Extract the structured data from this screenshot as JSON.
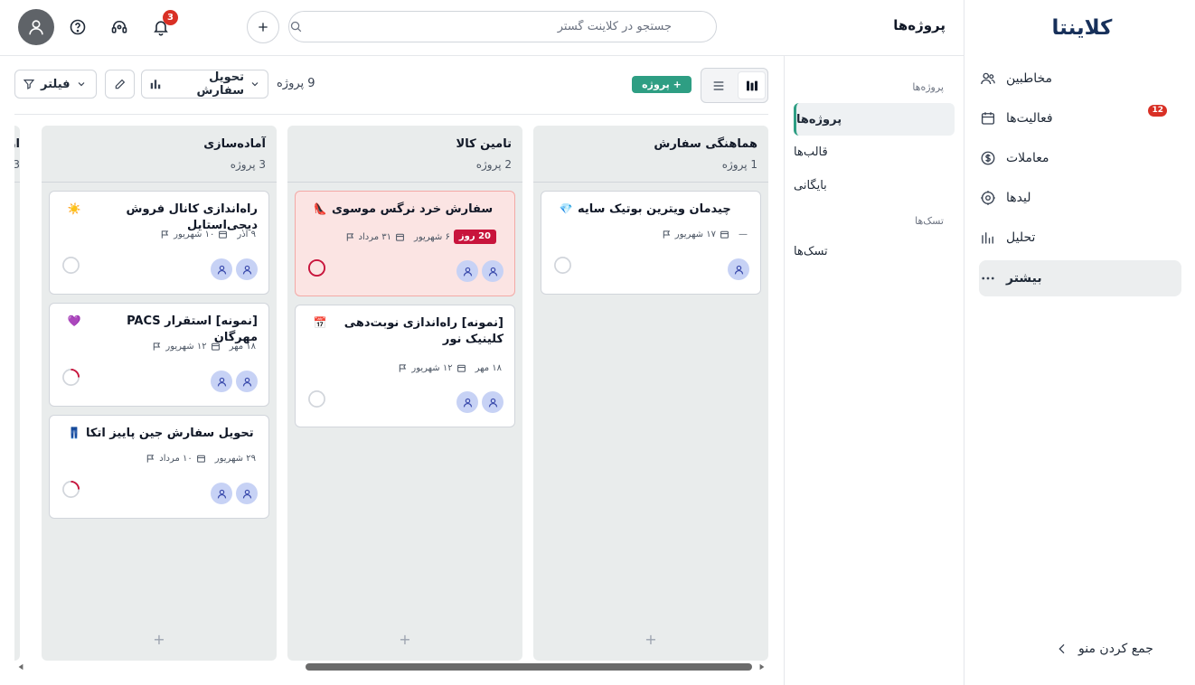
{
  "brand": {
    "logo": "کلاینتا"
  },
  "sidebar": {
    "items": [
      {
        "label": "مخاطبین",
        "icon": "contacts-icon"
      },
      {
        "label": "فعالیت‌ها",
        "icon": "calendar-icon",
        "badge": "12"
      },
      {
        "label": "معاملات",
        "icon": "dollar-icon"
      },
      {
        "label": "لیدها",
        "icon": "target-icon"
      },
      {
        "label": "تحلیل",
        "icon": "chart-icon"
      },
      {
        "label": "بیشتر",
        "icon": "more-icon"
      }
    ],
    "collapse_label": "جمع کردن منو"
  },
  "subnav": {
    "section_projects": "پروژه‌ها",
    "item_projects": "پروژه‌ها",
    "item_templates": "قالب‌ها",
    "item_archive": "بایگانی",
    "section_tasks": "تسک‌ها",
    "item_tasks": "تسک‌ها"
  },
  "header": {
    "page_title": "پروژه‌ها",
    "search_placeholder": "جستجو در کلاینت گستر",
    "notification_count": "3"
  },
  "toolbar": {
    "add_project_label": "+ پروژه",
    "project_count": "9 پروژه",
    "pipeline_label": "تحویل سفارش",
    "filter_label": "فیلتر"
  },
  "board": {
    "columns": [
      {
        "title": "هماهنگی سفارش",
        "count": "1 پروژه",
        "cards": [
          {
            "emoji": "💎",
            "title": "چیدمان ویترین بوتیک سایه",
            "start": "۱۷ شهریور",
            "end": "—",
            "overdue": "",
            "avatars": 1,
            "progress": 0
          }
        ]
      },
      {
        "title": "تامین کالا",
        "count": "2 پروژه",
        "cards": [
          {
            "emoji": "👠",
            "title": "سفارش خرد نرگس موسوی",
            "start": "۳۱ مرداد",
            "end": "۶ شهریور",
            "overdue": "20 روز",
            "avatars": 2,
            "progress": 1
          },
          {
            "emoji": "📅",
            "title": "[نمونه] راه‌اندازی نوبت‌دهی کلینیک نور",
            "start": "۱۲ شهریور",
            "end": "۱۸ مهر",
            "overdue": "",
            "avatars": 2,
            "progress": 0
          }
        ]
      },
      {
        "title": "آماده‌سازی",
        "count": "3 پروژه",
        "cards": [
          {
            "emoji": "☀️",
            "title": "راه‌اندازی کانال فروش دیجی‌استایل",
            "start": "۱۰ شهریور",
            "end": "۹ آذر",
            "overdue": "",
            "avatars": 2,
            "progress": 0
          },
          {
            "emoji": "💜",
            "title": "[نمونه] استقرار PACS مهرگان",
            "start": "۱۲ شهریور",
            "end": "۱۸ مهر",
            "overdue": "",
            "avatars": 2,
            "progress": 0.25
          },
          {
            "emoji": "👖",
            "title": "تحویل سفارش جین پاییز اتکا",
            "start": "۱۰ مرداد",
            "end": "۲۹ شهریور",
            "overdue": "",
            "avatars": 2,
            "progress": 0.25
          }
        ]
      },
      {
        "title": "ار",
        "count": "3",
        "cards": []
      }
    ]
  },
  "colors": {
    "accent": "#2e9e83",
    "danger": "#c8143c",
    "badge": "#d93025",
    "column_bg": "#e9ecec",
    "overdue_card_bg": "#fbe4e3"
  }
}
